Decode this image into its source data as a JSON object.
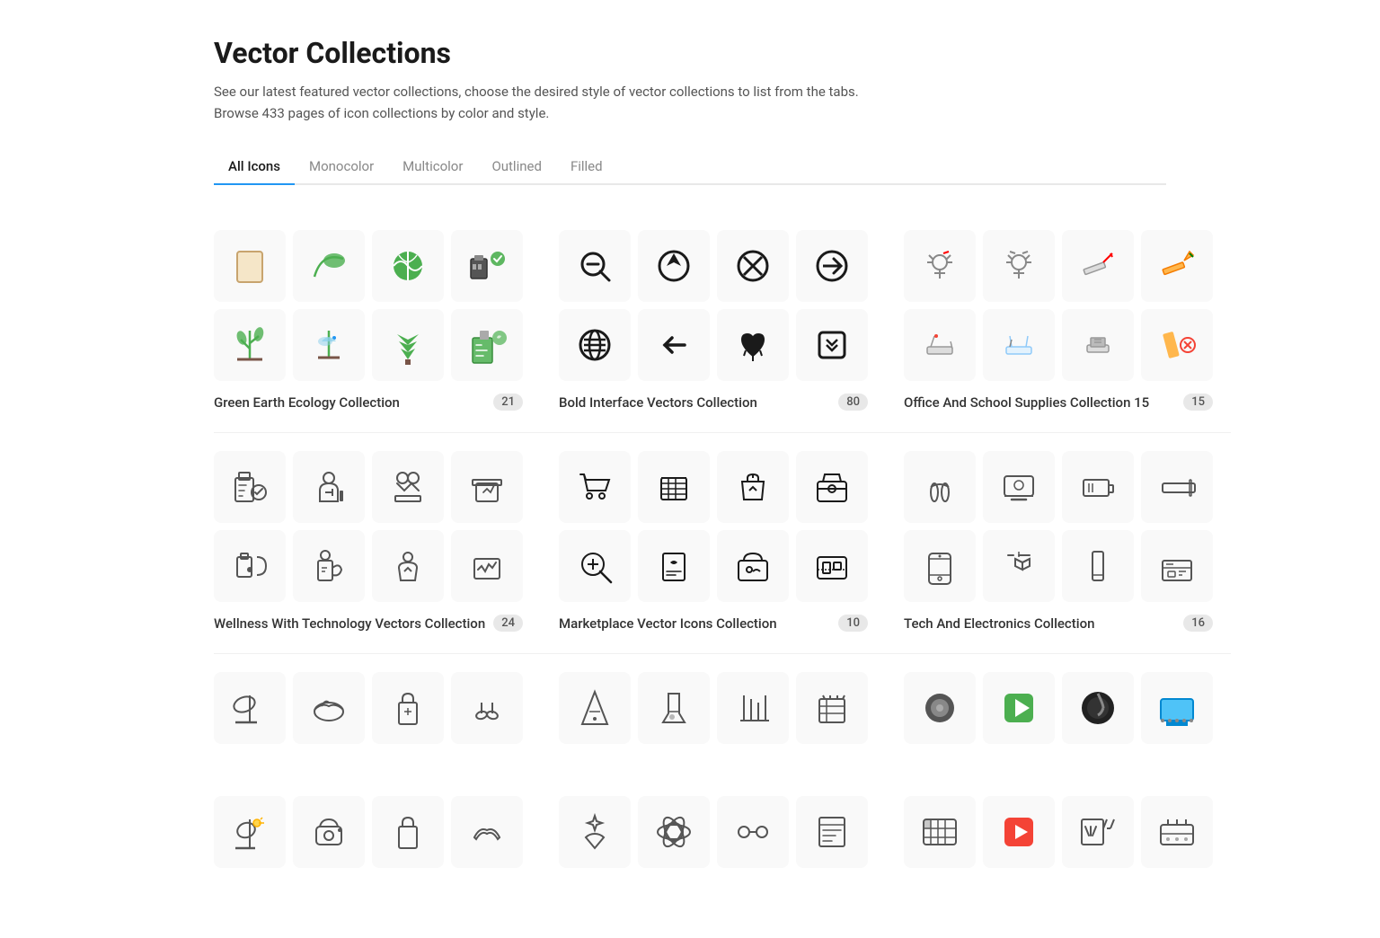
{
  "page": {
    "title": "Vector Collections",
    "description_line1": "See our latest featured vector collections, choose the desired style of vector collections to list from the tabs.",
    "description_line2": "Browse 433 pages of icon collections by color and style."
  },
  "tabs": [
    {
      "label": "All Icons",
      "active": true
    },
    {
      "label": "Monocolor",
      "active": false
    },
    {
      "label": "Multicolor",
      "active": false
    },
    {
      "label": "Outlined",
      "active": false
    },
    {
      "label": "Filled",
      "active": false
    }
  ],
  "collections": [
    {
      "name": "Green Earth Ecology Collection",
      "count": "21"
    },
    {
      "name": "Bold Interface Vectors Collection",
      "count": "80"
    },
    {
      "name": "Office And School Supplies Collection 15",
      "count": "15"
    },
    {
      "name": "Wellness With Technology Vectors Collection",
      "count": "24"
    },
    {
      "name": "Marketplace Vector Icons Collection",
      "count": "10"
    },
    {
      "name": "Tech And Electronics Collection",
      "count": "16"
    }
  ]
}
